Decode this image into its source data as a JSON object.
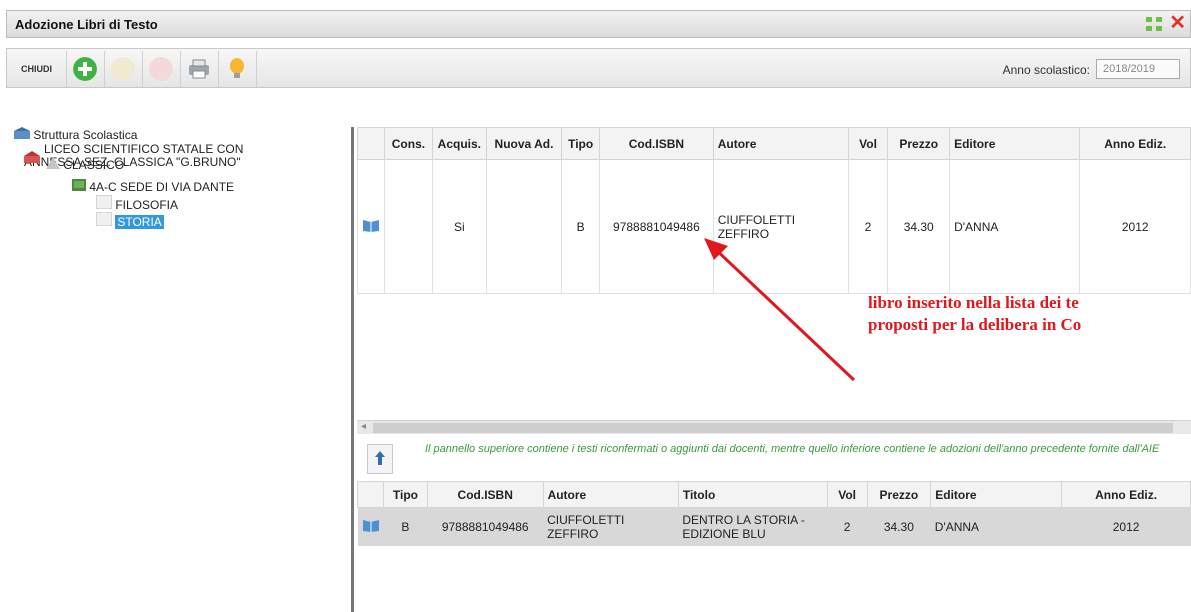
{
  "window": {
    "title": "Adozione Libri di Testo"
  },
  "toolbar": {
    "close_label": "CHIUDI",
    "year_label": "Anno scolastico:",
    "year_value": "2018/2019"
  },
  "tree": {
    "root": "Struttura Scolastica",
    "school_line1": "LICEO SCIENTIFICO STATALE CON",
    "school_line2": "ANNESSA SEZ. CLASSICA \"G.BRUNO\"",
    "section": "CLASSICO",
    "class": "4A-C SEDE DI VIA DANTE",
    "subject1": "FILOSOFIA",
    "subject2": "STORIA"
  },
  "top_table": {
    "headers": [
      "Cons.",
      "Acquis.",
      "Nuova Ad.",
      "Tipo",
      "Cod.ISBN",
      "Autore",
      "Vol",
      "Prezzo",
      "Editore",
      "Anno Ediz."
    ],
    "row": {
      "cons": "",
      "acquis": "Si",
      "nuova": "",
      "tipo": "B",
      "isbn": "9788881049486",
      "autore": "CIUFFOLETTI ZEFFIRO",
      "vol": "2",
      "prezzo": "34.30",
      "editore": "D'ANNA",
      "anno": "2012"
    }
  },
  "info": {
    "text": "Il pannello superiore contiene i testi riconfermati o aggiunti dai docenti, mentre quello inferiore contiene le adozioni dell'anno precedente fornite dall'AIE"
  },
  "bottom_table": {
    "headers": [
      "Tipo",
      "Cod.ISBN",
      "Autore",
      "Titolo",
      "Vol",
      "Prezzo",
      "Editore",
      "Anno Ediz."
    ],
    "row": {
      "tipo": "B",
      "isbn": "9788881049486",
      "autore": "CIUFFOLETTI ZEFFIRO",
      "titolo": "DENTRO LA STORIA - EDIZIONE BLU",
      "vol": "2",
      "prezzo": "34.30",
      "editore": "D'ANNA",
      "anno": "2012"
    }
  },
  "annotation": {
    "line1": "libro inserito nella lista dei te",
    "line2": "proposti per la delibera in Co"
  },
  "colors": {
    "accent_green": "#3a9a3a",
    "annotation_red": "#e0171c",
    "selection_blue": "#3399dd"
  },
  "icons": [
    "add-icon",
    "edit-icon",
    "delete-icon",
    "print-icon",
    "lightbulb-icon",
    "book-icon",
    "arrow-up-icon",
    "maximize-icon",
    "close-icon"
  ]
}
